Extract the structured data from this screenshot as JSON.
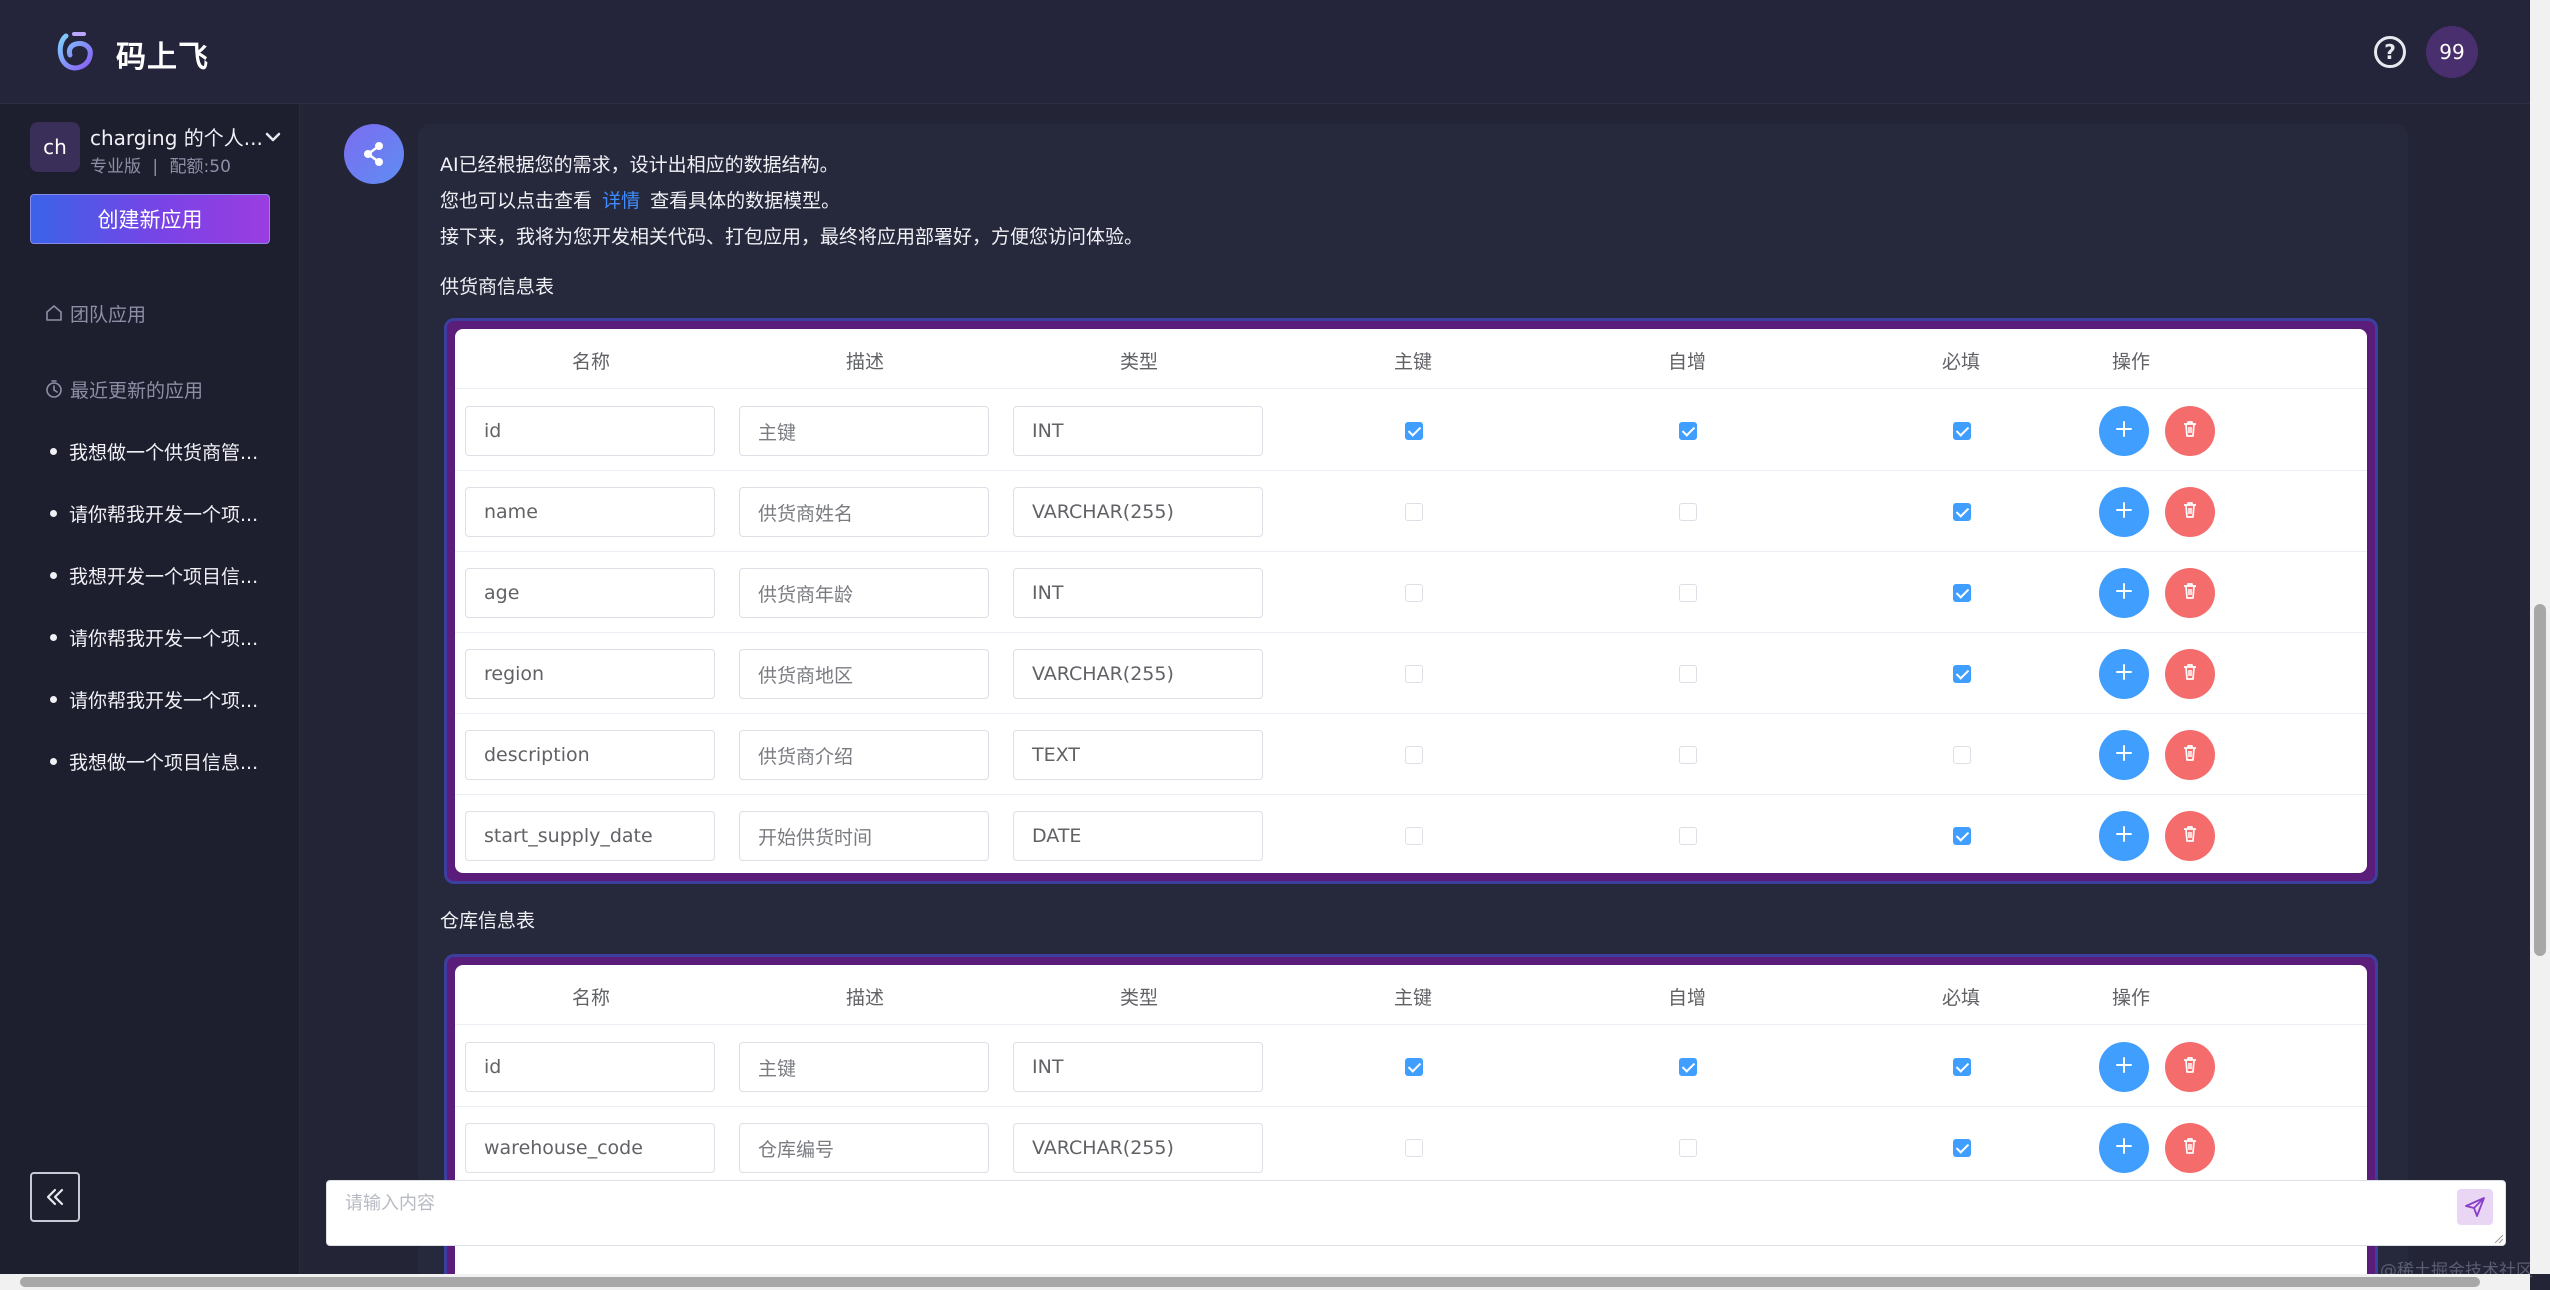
{
  "header": {
    "app_title": "码上飞",
    "logo_icon": "flying-code-logo",
    "help_icon": "question-circle-icon",
    "help_glyph": "?",
    "user_badge": "99"
  },
  "sidebar": {
    "account": {
      "initials": "ch",
      "name": "charging 的个人...",
      "plan": "专业版",
      "separator": "|",
      "quota": "配额:50"
    },
    "create_button": "创建新应用",
    "nav": {
      "team_apps": "团队应用",
      "recent_apps": "最近更新的应用"
    },
    "recent_items": [
      "我想做一个供货商管...",
      "请你帮我开发一个项...",
      "我想开发一个项目信...",
      "请你帮我开发一个项...",
      "请你帮我开发一个项...",
      "我想做一个项目信息..."
    ],
    "collapse_icon": "double-chevron-left-icon"
  },
  "message": {
    "line1": "AI已经根据您的需求，设计出相应的数据结构。",
    "line2_before": "您也可以点击查看",
    "line2_link": "详情",
    "line2_after": "查看具体的数据模型。",
    "line3": "接下来，我将为您开发相关代码、打包应用，最终将应用部署好，方便您访问体验。"
  },
  "table_headers": {
    "name": "名称",
    "desc": "描述",
    "type": "类型",
    "pk": "主键",
    "auto": "自增",
    "required": "必填",
    "ops": "操作"
  },
  "tables": [
    {
      "title": "供货商信息表",
      "rows": [
        {
          "name": "id",
          "desc": "主键",
          "type": "INT",
          "pk": true,
          "auto": true,
          "required": true
        },
        {
          "name": "name",
          "desc": "供货商姓名",
          "type": "VARCHAR(255)",
          "pk": false,
          "auto": false,
          "required": true
        },
        {
          "name": "age",
          "desc": "供货商年龄",
          "type": "INT",
          "pk": false,
          "auto": false,
          "required": true
        },
        {
          "name": "region",
          "desc": "供货商地区",
          "type": "VARCHAR(255)",
          "pk": false,
          "auto": false,
          "required": true
        },
        {
          "name": "description",
          "desc": "供货商介绍",
          "type": "TEXT",
          "pk": false,
          "auto": false,
          "required": false
        },
        {
          "name": "start_supply_date",
          "desc": "开始供货时间",
          "type": "DATE",
          "pk": false,
          "auto": false,
          "required": true
        }
      ]
    },
    {
      "title": "仓库信息表",
      "rows": [
        {
          "name": "id",
          "desc": "主键",
          "type": "INT",
          "pk": true,
          "auto": true,
          "required": true
        },
        {
          "name": "warehouse_code",
          "desc": "仓库编号",
          "type": "VARCHAR(255)",
          "pk": false,
          "auto": false,
          "required": true
        }
      ]
    }
  ],
  "chat": {
    "placeholder": "请输入内容",
    "send_icon": "send-icon"
  },
  "watermark": "@稀土掘金技术社区",
  "colors": {
    "accent_blue": "#409eff",
    "danger_red": "#f56c6c",
    "link_blue": "#3f8cff",
    "bg_dark": "#232436"
  }
}
